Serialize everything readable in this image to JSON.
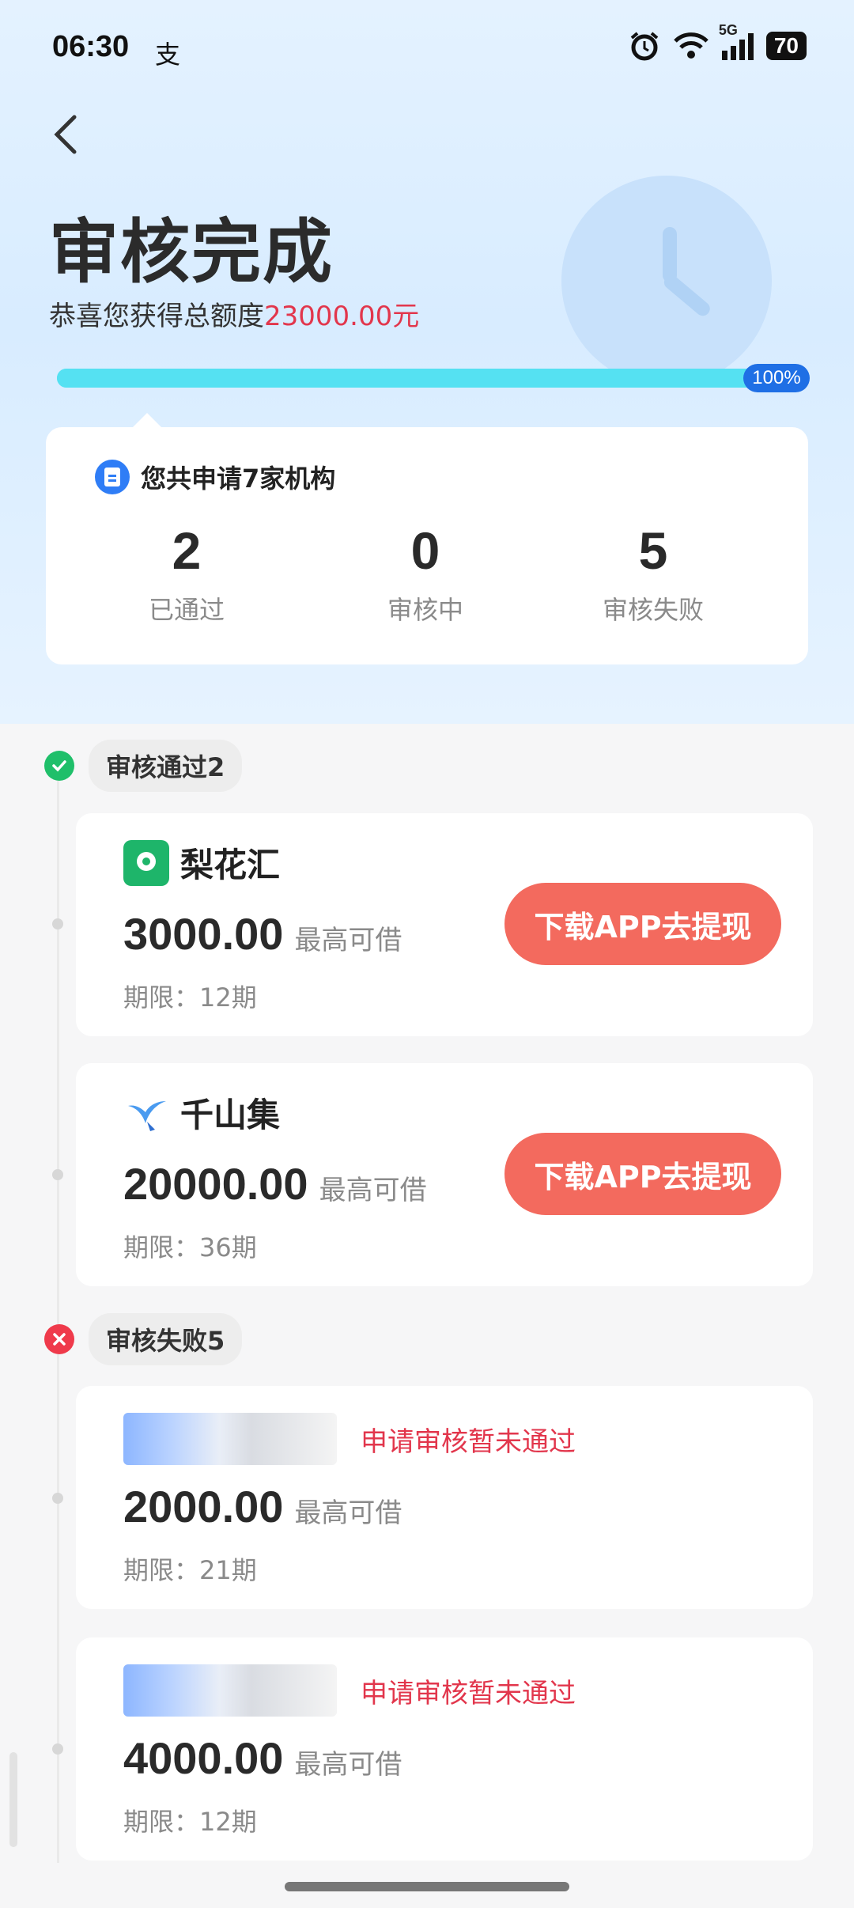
{
  "status_bar": {
    "time": "06:30",
    "app_glyph": "支",
    "network": "5G",
    "battery": "70"
  },
  "header": {
    "title": "审核完成",
    "subtitle_prefix": "恭喜您获得总额度",
    "total_amount": "23000.00元",
    "progress_percent": 100,
    "progress_label": "100%"
  },
  "summary": {
    "title": "您共申请7家机构",
    "stats": [
      {
        "value": "2",
        "label": "已通过"
      },
      {
        "value": "0",
        "label": "审核中"
      },
      {
        "value": "5",
        "label": "审核失败"
      }
    ]
  },
  "approved": {
    "label": "审核通过2",
    "items": [
      {
        "name": "梨花汇",
        "logo": "lihuahui-logo",
        "amount": "3000.00",
        "max_label": "最高可借",
        "period": "期限：12期",
        "cta": "下载APP去提现"
      },
      {
        "name": "千山集",
        "logo": "qianshanji-logo",
        "amount": "20000.00",
        "max_label": "最高可借",
        "period": "期限：36期",
        "cta": "下载APP去提现"
      }
    ]
  },
  "failed": {
    "label": "审核失败5",
    "items": [
      {
        "status": "申请审核暂未通过",
        "amount": "2000.00",
        "max_label": "最高可借",
        "period": "期限：21期"
      },
      {
        "status": "申请审核暂未通过",
        "amount": "4000.00",
        "max_label": "最高可借",
        "period": "期限：12期"
      }
    ]
  },
  "colors": {
    "accent_red": "#e2364c",
    "cta": "#f36a5e",
    "progress": "#55e1f2",
    "success": "#1fbf6a"
  }
}
